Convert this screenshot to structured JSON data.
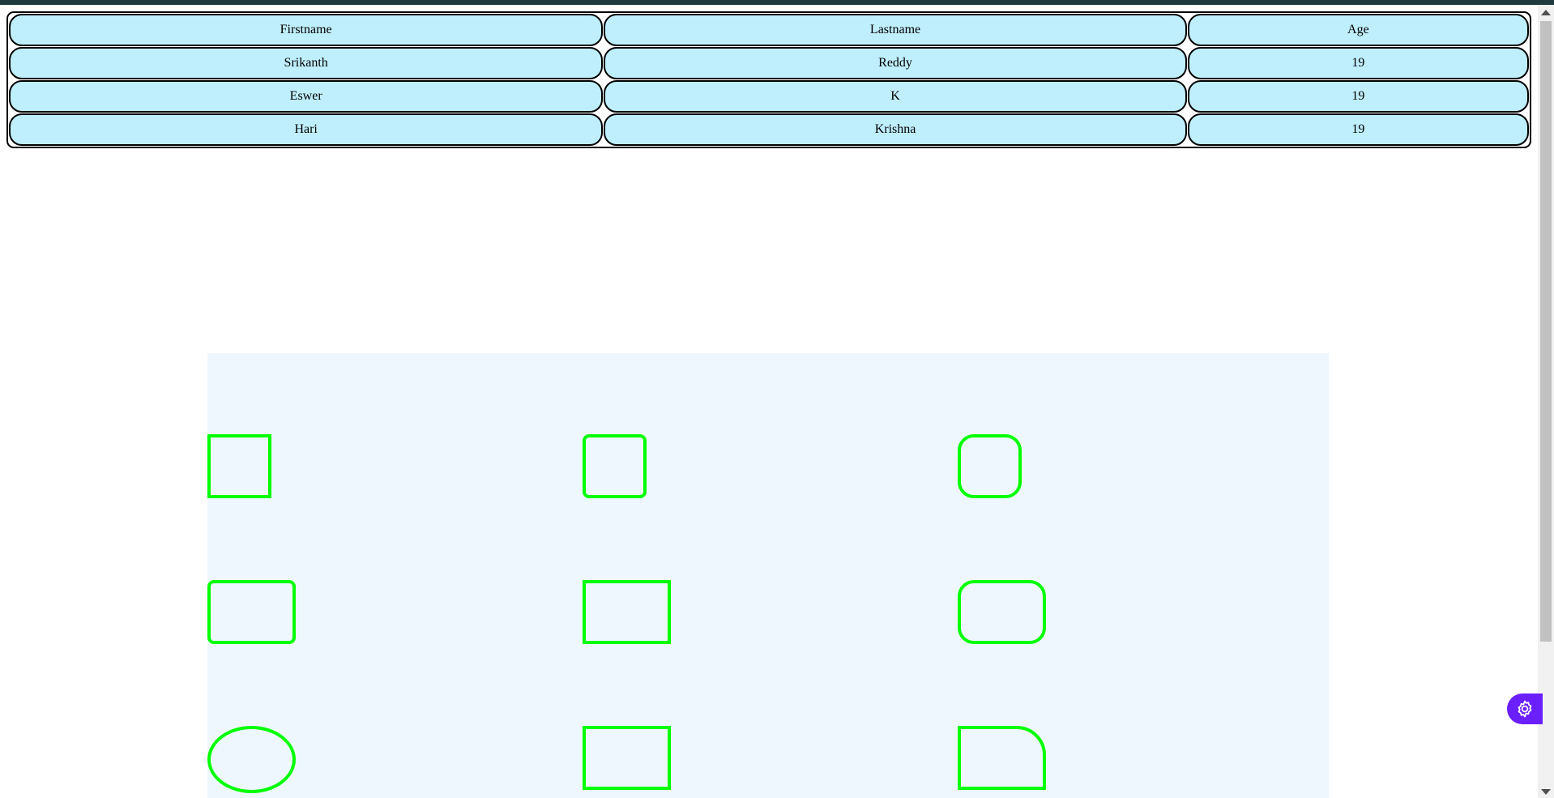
{
  "table": {
    "headers": [
      "Firstname",
      "Lastname",
      "Age"
    ],
    "rows": [
      [
        "Srikanth",
        "Reddy",
        "19"
      ],
      [
        "Eswer",
        "K",
        "19"
      ],
      [
        "Hari",
        "Krishna",
        "19"
      ]
    ]
  },
  "shapes": {
    "stroke_color": "#00ff00",
    "area_background": "#eef7fd",
    "items": [
      {
        "kind": "square"
      },
      {
        "kind": "rounded-square"
      },
      {
        "kind": "more-rounded-square"
      },
      {
        "kind": "rounded-rectangle"
      },
      {
        "kind": "rectangle"
      },
      {
        "kind": "more-rounded-rectangle"
      },
      {
        "kind": "ellipse"
      },
      {
        "kind": "rectangle"
      },
      {
        "kind": "rectangle-rounded-top-right"
      }
    ]
  },
  "colors": {
    "cell_background": "#bfeffc",
    "cell_border": "#000000",
    "top_bar": "#1f3a3d",
    "assist_button": "#6a1fff"
  },
  "icons": {
    "assist": "settings-gear-icon"
  }
}
